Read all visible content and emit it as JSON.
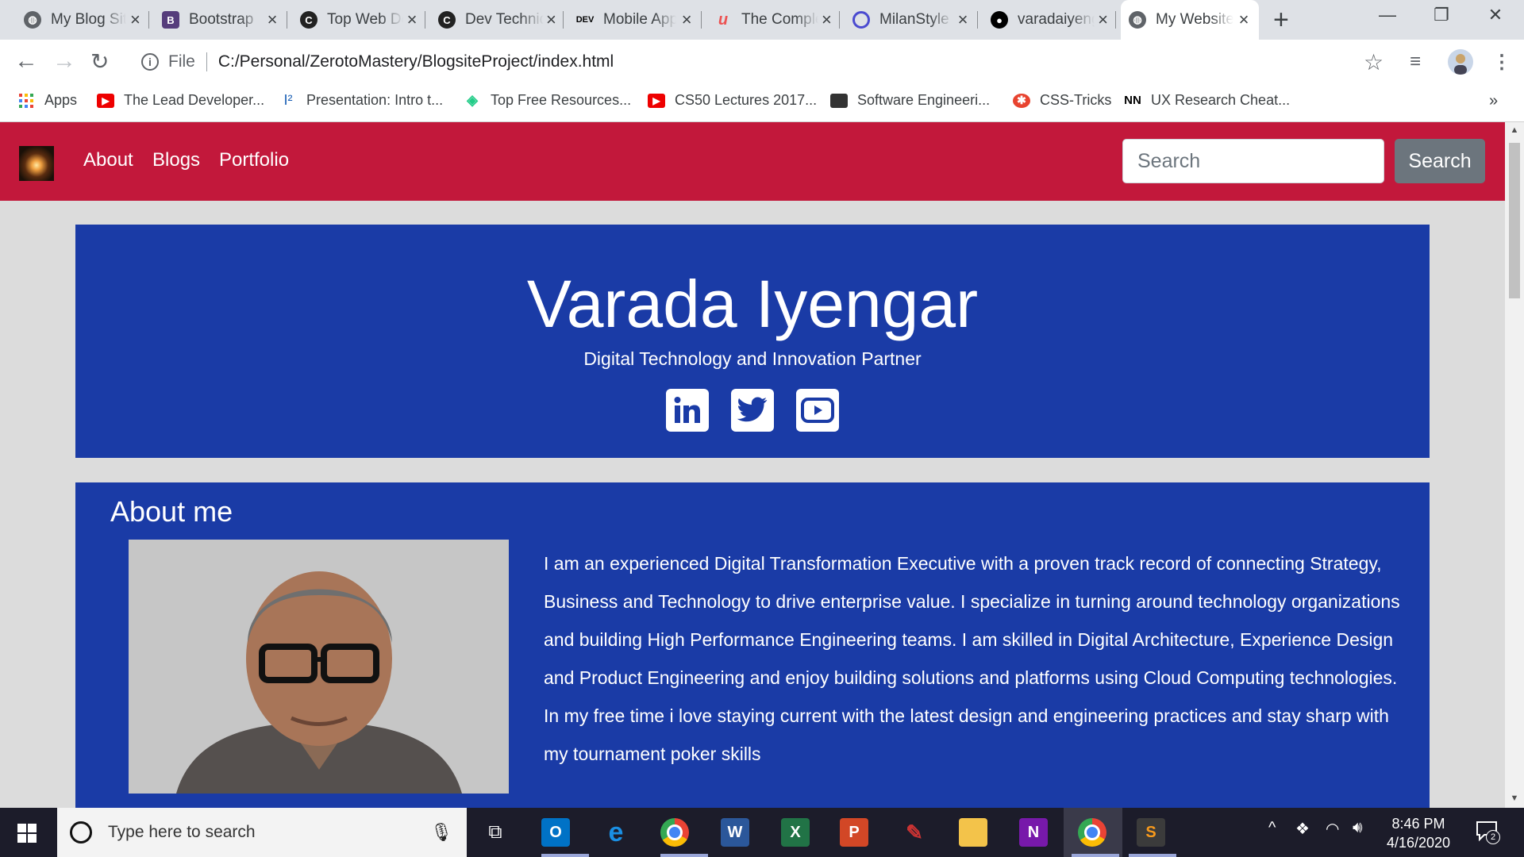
{
  "browser": {
    "tabs": [
      {
        "title": "My Blog Site",
        "icon": "globe-icon",
        "color": "#5f6368"
      },
      {
        "title": "Bootstrap",
        "icon": "bootstrap-icon",
        "color": "#563d7c"
      },
      {
        "title": "Top Web Dev",
        "icon": "c-logo-icon",
        "color": "#d22"
      },
      {
        "title": "Dev Techniques",
        "icon": "c-logo-icon",
        "color": "#d22"
      },
      {
        "title": "Mobile App",
        "icon": "dev-icon",
        "color": "#000"
      },
      {
        "title": "The Complete",
        "icon": "udemy-icon",
        "color": "#ec5252"
      },
      {
        "title": "MilanStyle",
        "icon": "ring-icon",
        "color": "#4a4ad0"
      },
      {
        "title": "varadaiyengar",
        "icon": "github-icon",
        "color": "#000"
      },
      {
        "title": "My Website",
        "icon": "globe-icon",
        "color": "#5f6368",
        "active": true
      }
    ],
    "address": {
      "scheme_label": "File",
      "url": "C:/Personal/ZerotoMastery/BlogsiteProject/index.html"
    },
    "bookmarks": [
      {
        "label": "Apps",
        "icon": "apps-grid-icon"
      },
      {
        "label": "The Lead Developer...",
        "icon": "youtube-icon"
      },
      {
        "label": "Presentation: Intro t...",
        "icon": "i2-icon"
      },
      {
        "label": "Top Free Resources...",
        "icon": "layers-icon"
      },
      {
        "label": "CS50 Lectures 2017...",
        "icon": "youtube-icon"
      },
      {
        "label": "Software Engineeri...",
        "icon": "laptop-icon"
      },
      {
        "label": "CSS-Tricks",
        "icon": "csstricks-icon"
      },
      {
        "label": "UX Research Cheat...",
        "icon": "nn-icon"
      }
    ],
    "overflow_label": "»"
  },
  "site": {
    "nav": [
      "About",
      "Blogs",
      "Portfolio"
    ],
    "search": {
      "placeholder": "Search",
      "button": "Search"
    },
    "hero": {
      "name": "Varada Iyengar",
      "tagline": "Digital Technology and Innovation Partner",
      "social": [
        "linkedin-icon",
        "twitter-icon",
        "youtube-icon"
      ]
    },
    "about": {
      "heading": "About me",
      "text": "I am an experienced Digital Transformation Executive with a proven track record of connecting Strategy, Business and Technology to drive enterprise value. I specialize in turning around technology organizations and building High Performance Engineering teams. I am skilled in Digital Architecture, Experience Design and Product Engineering and enjoy building solutions and platforms using Cloud Computing technologies. In my free time i love staying current with the latest design and engineering practices and stay sharp with my tournament poker skills"
    },
    "colors": {
      "navbar": "#c2183b",
      "panel": "#1a3ba6",
      "page_bg": "#dcdcdc"
    }
  },
  "taskbar": {
    "search_placeholder": "Type here to search",
    "apps": [
      "task-view-icon",
      "outlook-icon",
      "edge-icon",
      "chrome-icon",
      "word-icon",
      "excel-icon",
      "powerpoint-icon",
      "paint-icon",
      "file-explorer-icon",
      "onenote-icon",
      "chrome-active-icon",
      "sublime-icon"
    ],
    "time": "8:46 PM",
    "date": "4/16/2020",
    "notification_count": "2"
  }
}
